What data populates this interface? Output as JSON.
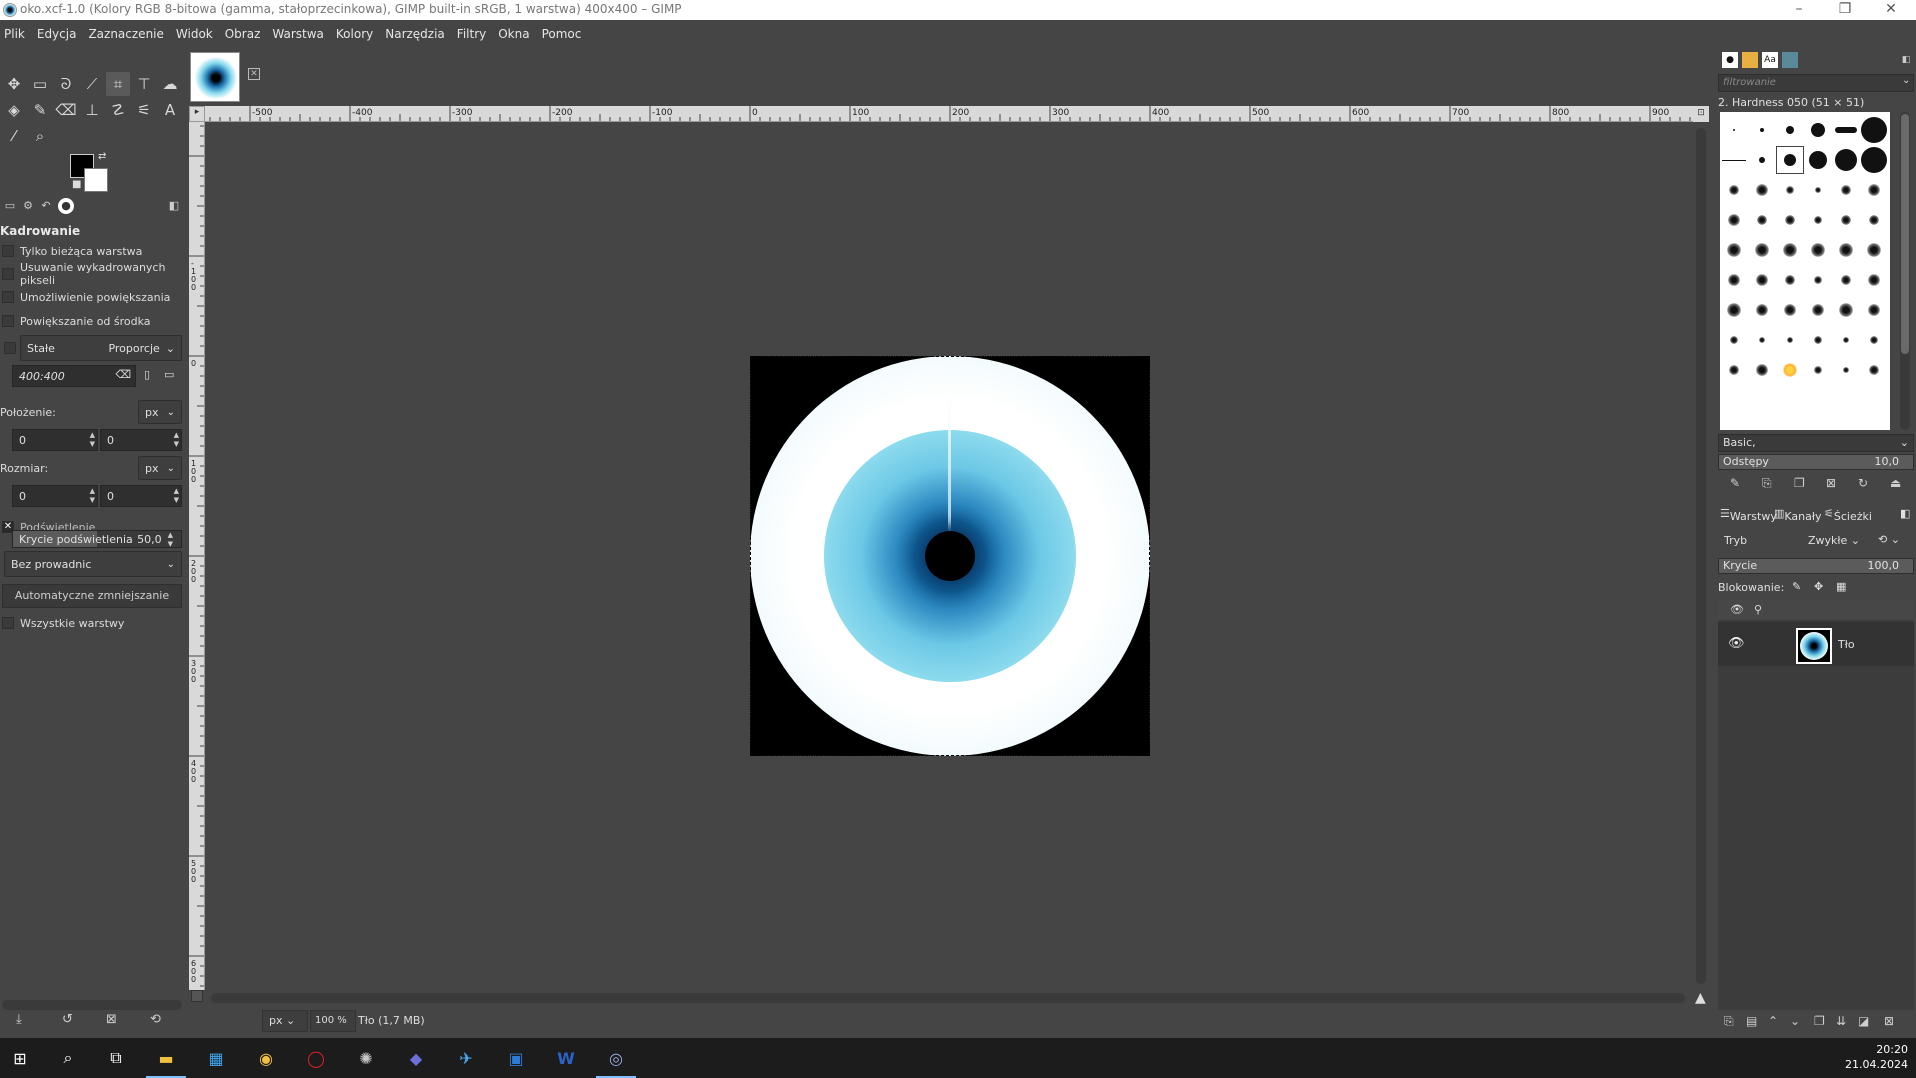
{
  "window": {
    "title": "oko.xcf-1.0 (Kolory RGB 8-bitowa (gamma, stałoprzecinkowa), GIMP built-in sRGB, 1 warstwa) 400x400 – GIMP",
    "minimize": "–",
    "maximize": "❐",
    "close": "✕"
  },
  "menu": [
    "Plik",
    "Edycja",
    "Zaznaczenie",
    "Widok",
    "Obraz",
    "Warstwa",
    "Kolory",
    "Narzędzia",
    "Filtry",
    "Okna",
    "Pomoc"
  ],
  "tools": [
    {
      "name": "move-tool-icon",
      "glyph": "✥"
    },
    {
      "name": "rect-select-tool-icon",
      "glyph": "▭"
    },
    {
      "name": "lasso-tool-icon",
      "glyph": "ᘐ"
    },
    {
      "name": "fuzzy-select-tool-icon",
      "glyph": "⟋"
    },
    {
      "name": "crop-tool-icon",
      "glyph": "⌗"
    },
    {
      "name": "unified-transform-tool-icon",
      "glyph": "⊤"
    },
    {
      "name": "warp-tool-icon",
      "glyph": "☁"
    },
    {
      "name": "bucket-fill-tool-icon",
      "glyph": "◈"
    },
    {
      "name": "paintbrush-tool-icon",
      "glyph": "✎"
    },
    {
      "name": "eraser-tool-icon",
      "glyph": "⌫"
    },
    {
      "name": "clone-tool-icon",
      "glyph": "⊥"
    },
    {
      "name": "smudge-tool-icon",
      "glyph": "☡"
    },
    {
      "name": "paths-tool-icon",
      "glyph": "⚟"
    },
    {
      "name": "text-tool-icon",
      "glyph": "A"
    },
    {
      "name": "color-picker-tool-icon",
      "glyph": "⁄"
    },
    {
      "name": "zoom-tool-icon",
      "glyph": "⌕"
    }
  ],
  "tool_options": {
    "title": "Kadrowanie",
    "current_layer_only": "Tylko bieżąca warstwa",
    "delete_cropped": "Usuwanie wykadrowanych pikseli",
    "allow_growing": "Umożliwienie powiększania",
    "expand_from_center": "Powiększanie od środka",
    "fixed_label": "Stałe",
    "fixed_mode": "Proporcje",
    "aspect": "400:400",
    "position_label": "Położenie:",
    "position_unit": "px",
    "pos_x": "0",
    "pos_y": "0",
    "size_label": "Rozmiar:",
    "size_unit": "px",
    "size_w": "0",
    "size_h": "0",
    "highlight": "Podświetlenie",
    "highlight_opacity_label": "Krycie podświetlenia",
    "highlight_opacity_value": "50,0",
    "guides": "Bez prowadnic",
    "auto_shrink": "Automatyczne zmniejszanie",
    "all_layers": "Wszystkie warstwy"
  },
  "rulers": {
    "h_ticks": [
      "-500",
      "-400",
      "-300",
      "-200",
      "-100",
      "0",
      "100",
      "200",
      "300",
      "400",
      "500",
      "600",
      "700",
      "800",
      "900"
    ],
    "v_ticks": [
      "-100",
      "0",
      "100",
      "200",
      "300",
      "400",
      "500",
      "600"
    ]
  },
  "statusbar": {
    "unit": "px",
    "zoom": "100 %",
    "info": "Tło (1,7 MB)"
  },
  "brushes": {
    "filter_placeholder": "filtrowanie",
    "selected_brush": "2. Hardness 050 (51 × 51)",
    "set": "Basic,",
    "spacing_label": "Odstępy",
    "spacing_value": "10,0"
  },
  "layers": {
    "tab_layers": "Warstwy",
    "tab_channels": "Kanały",
    "tab_paths": "Ścieżki",
    "mode_label": "Tryb",
    "mode_value": "Zwykłe",
    "opacity_label": "Krycie",
    "opacity_value": "100,0",
    "lock_label": "Blokowanie:",
    "layer_name": "Tło"
  },
  "taskbar": {
    "time": "20:20",
    "date": "21.04.2024"
  },
  "colors": {
    "fg": "#000000",
    "bg": "#ffffff",
    "ui_bg": "#454545"
  }
}
